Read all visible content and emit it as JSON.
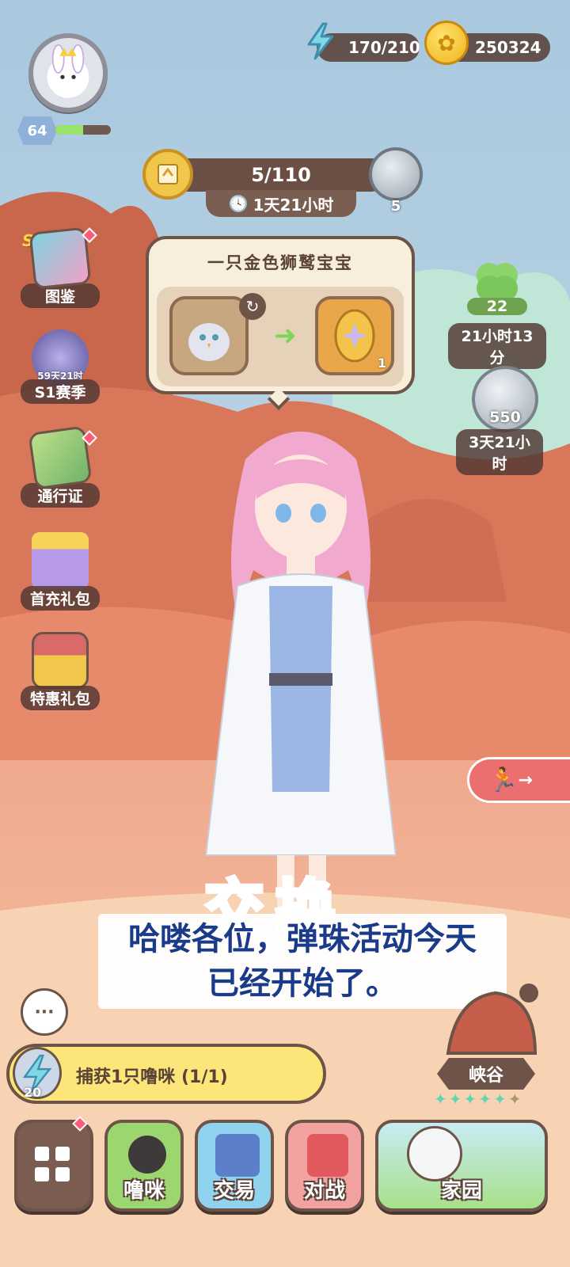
{
  "player": {
    "level": "64",
    "xp_fraction": 0.5
  },
  "resources": {
    "energy": "170/210",
    "coins": "250324"
  },
  "event": {
    "progress": "5/110",
    "timer": "1天21小时",
    "silver_count": "5"
  },
  "side_menu": [
    {
      "label": "图鉴",
      "tag": "S1",
      "icon": "card-book-icon",
      "red_dot": true
    },
    {
      "label": "S1赛季",
      "sub": "59天21时",
      "icon": "helmet-sword-icon",
      "red_dot": false
    },
    {
      "label": "通行证",
      "icon": "pass-book-icon",
      "red_dot": true
    },
    {
      "label": "首充礼包",
      "icon": "gift-box-icon",
      "red_dot": false
    },
    {
      "label": "特惠礼包",
      "icon": "treasure-chest-icon",
      "red_dot": false
    }
  ],
  "exchange_popup": {
    "title": "一只金色狮鹫宝宝",
    "egg_count": "1"
  },
  "right_panel": {
    "clover_count": "22",
    "clover_timer": "21小时13分",
    "silver_count": "550",
    "silver_timer": "3天21小时"
  },
  "big_word": "交换",
  "subtitle": {
    "line1": "哈喽各位，弹珠活动今天",
    "line2": "已经开始了。"
  },
  "quest": {
    "text": "捕获1只噜咪 (1/1)",
    "reward": "20"
  },
  "canyon": {
    "label": "峡谷",
    "stars_filled": 5,
    "stars_total": 6
  },
  "bottom_nav": [
    {
      "label": "",
      "icon": "menu-grid-icon"
    },
    {
      "label": "噜咪",
      "icon": "pet-bowl-icon"
    },
    {
      "label": "交易",
      "icon": "trade-machine-icon"
    },
    {
      "label": "对战",
      "icon": "battle-cards-icon"
    },
    {
      "label": "家园",
      "icon": "home-cat-icon"
    }
  ],
  "colors": {
    "accent": "#6e5448",
    "quest_bg": "#fce67a",
    "subtitle_text": "#1a3a8a"
  }
}
